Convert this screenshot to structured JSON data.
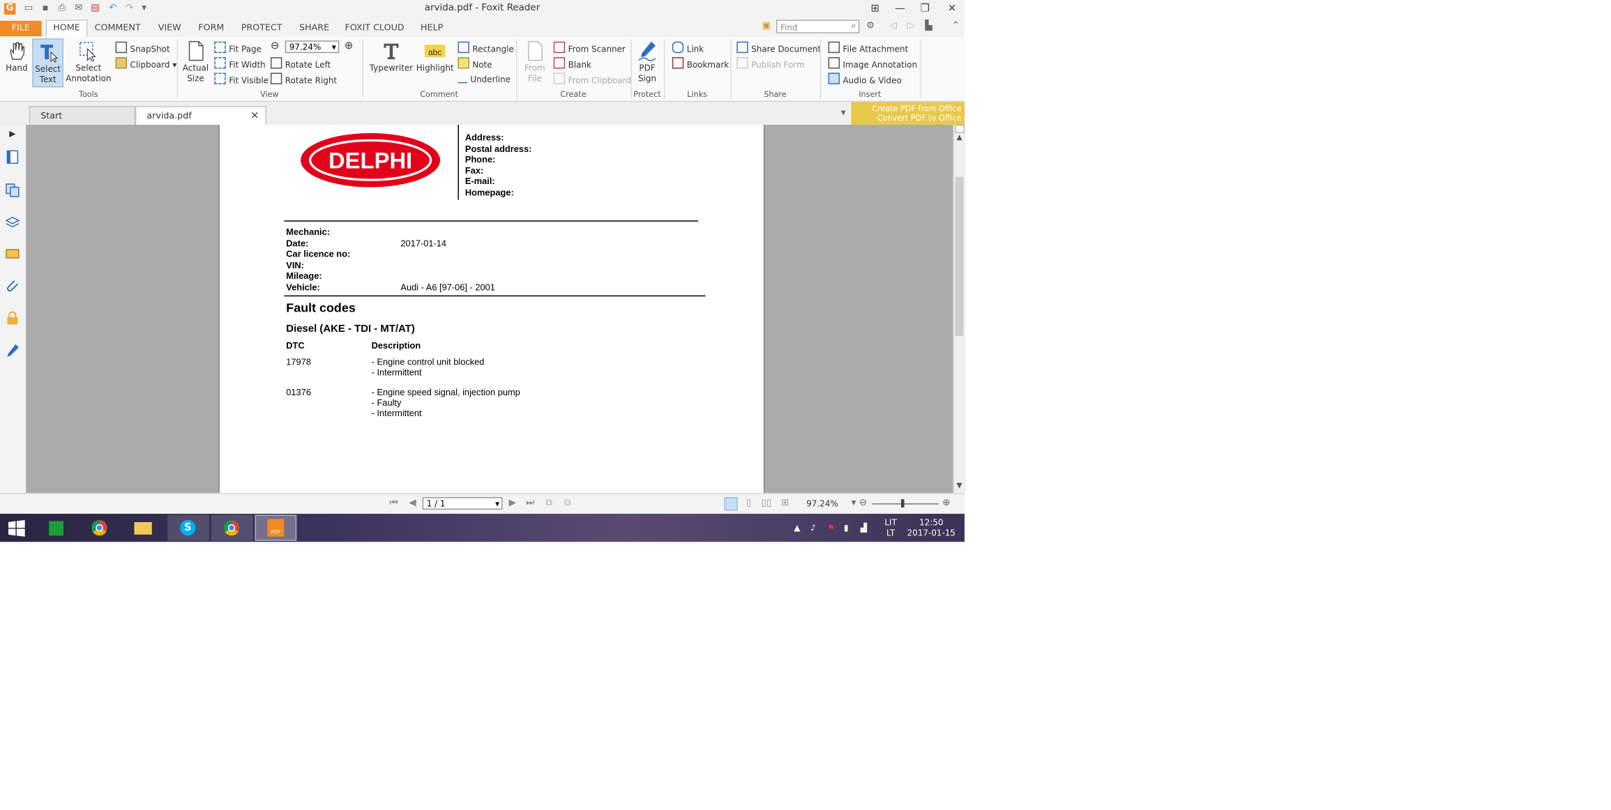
{
  "window": {
    "title": "arvida.pdf - Foxit Reader"
  },
  "menu": {
    "tabs": [
      "FILE",
      "HOME",
      "COMMENT",
      "VIEW",
      "FORM",
      "PROTECT",
      "SHARE",
      "FOXIT CLOUD",
      "HELP"
    ],
    "search_placeholder": "Find"
  },
  "ribbon": {
    "tools": {
      "hand": "Hand",
      "select_text_1": "Select",
      "select_text_2": "Text",
      "select_annot_1": "Select",
      "select_annot_2": "Annotation",
      "snapshot": "SnapShot",
      "clipboard": "Clipboard",
      "label": "Tools"
    },
    "view": {
      "actual_1": "Actual",
      "actual_2": "Size",
      "fit_page": "Fit Page",
      "fit_width": "Fit Width",
      "fit_visible": "Fit Visible",
      "zoom": "97.24%",
      "rotate_left": "Rotate Left",
      "rotate_right": "Rotate Right",
      "label": "View"
    },
    "comment": {
      "typewriter": "Typewriter",
      "highlight": "Highlight",
      "rectangle": "Rectangle",
      "note": "Note",
      "underline": "Underline",
      "label": "Comment"
    },
    "create": {
      "from_file_1": "From",
      "from_file_2": "File",
      "from_scanner": "From Scanner",
      "blank": "Blank",
      "from_clipboard": "From Clipboard",
      "label": "Create"
    },
    "protect": {
      "pdf_sign_1": "PDF",
      "pdf_sign_2": "Sign",
      "label": "Protect"
    },
    "links": {
      "link": "Link",
      "bookmark": "Bookmark",
      "label": "Links"
    },
    "share": {
      "share_document": "Share Document",
      "publish_form": "Publish Form",
      "label": "Share"
    },
    "insert": {
      "file_attachment": "File Attachment",
      "image_annotation": "Image Annotation",
      "audio_video": "Audio & Video",
      "label": "Insert"
    }
  },
  "doc_tabs": {
    "start": "Start",
    "current": "arvida.pdf",
    "close": "×"
  },
  "banner": {
    "line1": "Create PDF from Office",
    "line2": "Convert PDF to Office"
  },
  "document": {
    "logo_text": "DELPHI",
    "contact_labels": [
      "Address:",
      "Postal address:",
      "Phone:",
      "Fax:",
      "E-mail:",
      "Homepage:"
    ],
    "info_labels": [
      "Mechanic:",
      "Date:",
      "Car licence no:",
      "VIN:",
      "Mileage:",
      "Vehicle:"
    ],
    "date": "2017-01-14",
    "vehicle": "Audi - A6 [97-06] - 2001",
    "section_title": "Fault codes",
    "system_title": "Diesel (AKE - TDI - MT/AT)",
    "col_dtc": "DTC",
    "col_desc": "Description",
    "faults": [
      {
        "code": "17978",
        "lines": [
          "- Engine control unit blocked",
          "- Intermittent"
        ]
      },
      {
        "code": "01376",
        "lines": [
          "- Engine speed signal, injection pump",
          "- Faulty",
          "- Intermittent"
        ]
      }
    ]
  },
  "status": {
    "page": "1 / 1",
    "zoom": "97.24%"
  },
  "taskbar": {
    "lang_1": "LIT",
    "lang_2": "LT",
    "time": "12:50",
    "date": "2017-01-15",
    "foxit_label": "PDF"
  },
  "colors": {
    "accent": "#f08a24",
    "delphi_red": "#e2001a",
    "selected": "#c7ddf2"
  }
}
